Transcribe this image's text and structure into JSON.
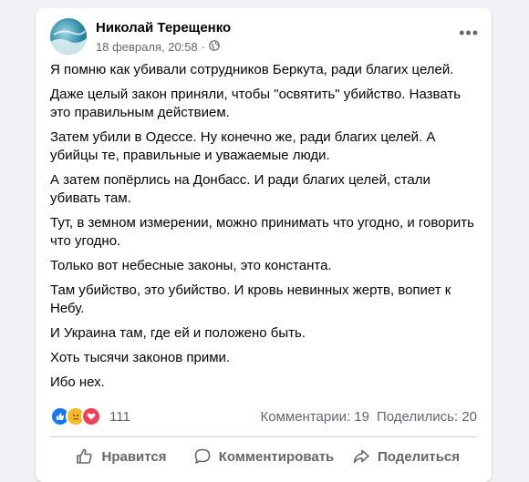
{
  "post": {
    "author": "Николай Терещенко",
    "date": "18 февраля, 20:58",
    "separator": "·",
    "more_icon": "more-horizontal-icon",
    "paragraphs": [
      "Я помню как убивали сотрудников Беркута, ради благих целей.",
      "Даже целый закон приняли, чтобы \"освятить\" убийство. Назвать это правильным действием.",
      "Затем убили в Одессе. Ну конечно же, ради благих целей. А убийцы те, правильные и уважаемые люди.",
      "А затем попёрлись на Донбасс. И ради благих целей, стали убивать там.",
      "Тут, в земном измерении, можно принимать что угодно, и говорить что угодно.",
      "Только вот небесные законы, это константа.",
      "Там убийство, это убийство. И кровь невинных жертв, вопиет к Небу.",
      "И Украина там, где ей и положено быть.",
      "Хоть тысячи законов прими.",
      "Ибо нех."
    ]
  },
  "stats": {
    "reactions_count": "111",
    "comments": "Комментарии: 19",
    "shares": "Поделились: 20"
  },
  "actions": {
    "like": "Нравится",
    "comment": "Комментировать",
    "share": "Поделиться"
  },
  "colors": {
    "like_blue": "#1877f2",
    "sad_yellow": "#f7b928",
    "love_red": "#f33e58",
    "muted_text": "#65676b"
  }
}
